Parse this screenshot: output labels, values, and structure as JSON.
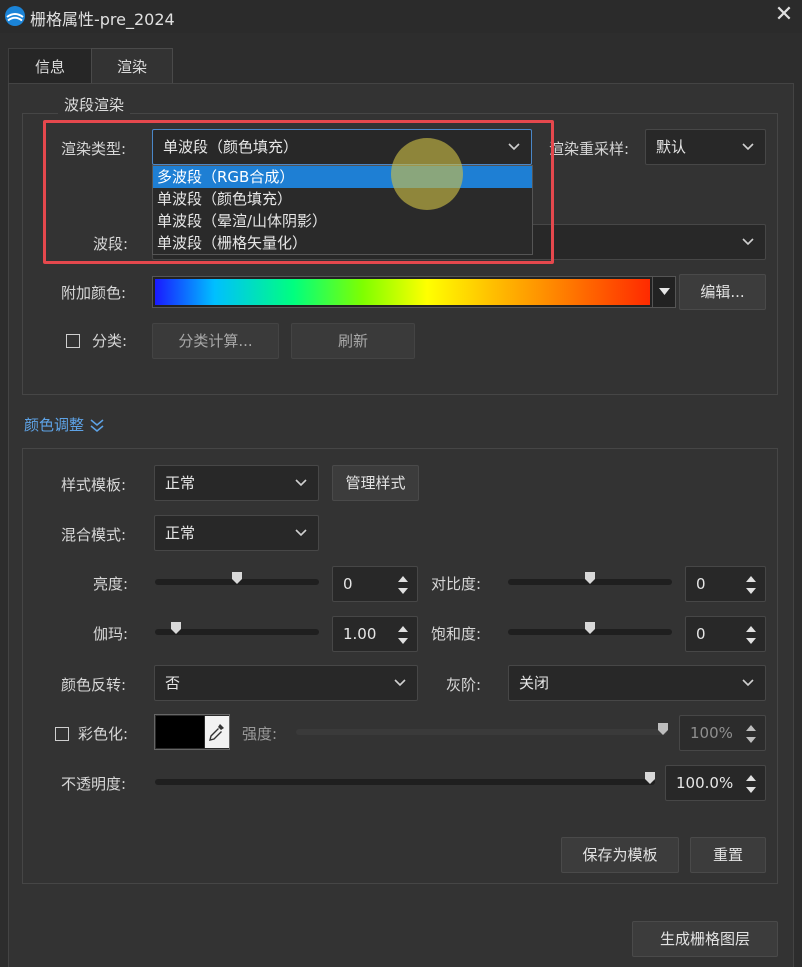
{
  "window": {
    "title": "栅格属性-pre_2024",
    "close_glyph": "✕"
  },
  "tabs": [
    {
      "label": "信息",
      "active": false
    },
    {
      "label": "渲染",
      "active": true
    }
  ],
  "band_render": {
    "group_title": "波段渲染",
    "render_type_label": "渲染类型:",
    "render_type_value": "单波段（颜色填充）",
    "render_type_options": [
      "多波段（RGB合成）",
      "单波段（颜色填充）",
      "单波段（晕渲/山体阴影）",
      "单波段（栅格矢量化）"
    ],
    "hovered_option": "多波段（RGB合成）",
    "resample_label": "渲染重采样:",
    "resample_value": "默认",
    "band_label": "波段:",
    "band_value": "",
    "extra_color_label": "附加颜色:",
    "edit_button": "编辑...",
    "classify_label": "分类:",
    "classify_checked": false,
    "classify_compute_button": "分类计算...",
    "refresh_button": "刷新"
  },
  "color_adjust": {
    "section_title": "颜色调整",
    "style_template_label": "样式模板:",
    "style_template_value": "正常",
    "manage_styles_button": "管理样式",
    "blend_mode_label": "混合模式:",
    "blend_mode_value": "正常",
    "brightness_label": "亮度:",
    "brightness_value": "0",
    "contrast_label": "对比度:",
    "contrast_value": "0",
    "gamma_label": "伽玛:",
    "gamma_value": "1.00",
    "saturation_label": "饱和度:",
    "saturation_value": "0",
    "invert_label": "颜色反转:",
    "invert_value": "否",
    "grayscale_label": "灰阶:",
    "grayscale_value": "关闭",
    "colorize_label": "彩色化:",
    "colorize_checked": false,
    "colorize_swatch_color": "#000000",
    "strength_label": "强度:",
    "strength_value": "100%",
    "opacity_label": "不透明度:",
    "opacity_value": "100.0%",
    "save_template_button": "保存为模板",
    "reset_button": "重置"
  },
  "footer": {
    "generate_button": "生成栅格图层"
  },
  "colors": {
    "window_bg": "#2d2d2d",
    "panel_bg": "#333333",
    "selection_blue": "#1e7fd4",
    "link_blue": "#5ea3e6",
    "highlight_red": "#e5484d"
  },
  "icons": {
    "app": "globe-wave-icon",
    "chevron": "chevron-down-icon",
    "eyedropper": "eyedropper-icon"
  }
}
